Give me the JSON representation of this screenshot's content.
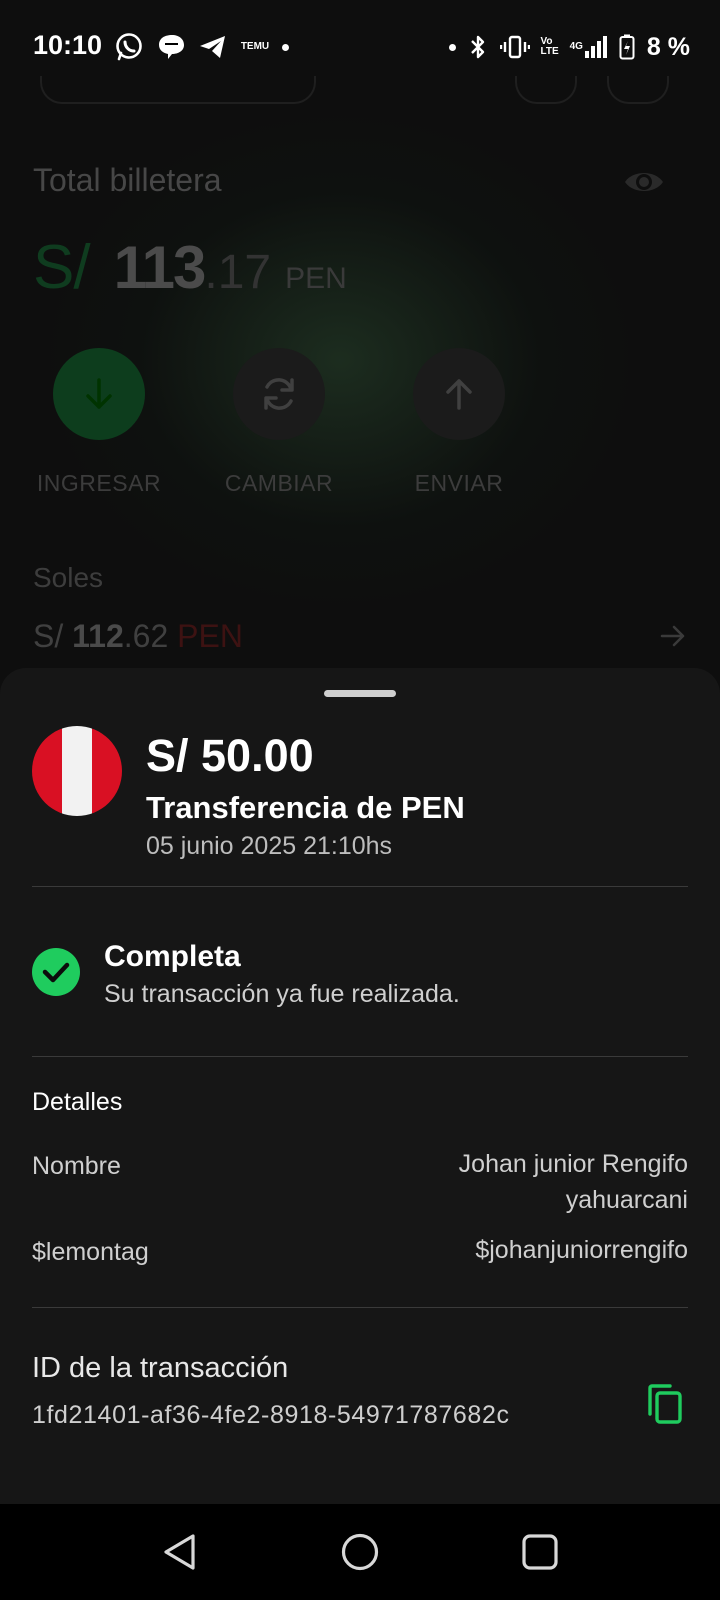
{
  "status_bar": {
    "time": "10:10",
    "temu_label": "TEMU",
    "signal_label": "Vo LTE",
    "network_label": "4G",
    "battery": "8 %"
  },
  "background": {
    "wallet_label": "Total billetera",
    "balance": {
      "currency": "S/",
      "integer": "113",
      "decimal": ".17",
      "code": "PEN"
    },
    "actions": [
      {
        "label": "INGRESAR",
        "icon": "arrow-down-icon"
      },
      {
        "label": "CAMBIAR",
        "icon": "refresh-icon"
      },
      {
        "label": "ENVIAR",
        "icon": "arrow-up-icon"
      }
    ],
    "soles_label": "Soles",
    "soles_balance": {
      "currency": "S/",
      "integer": "112",
      "decimal": ".62",
      "code": "PEN"
    }
  },
  "sheet": {
    "amount": "S/ 50.00",
    "title": "Transferencia de PEN",
    "date": "05 junio 2025 21:10hs",
    "status_title": "Completa",
    "status_desc": "Su transacción ya fue realizada.",
    "details_heading": "Detalles",
    "details": [
      {
        "label": "Nombre",
        "value_line1": "Johan junior Rengifo",
        "value_line2": "yahuarcani"
      },
      {
        "label": "$lemontag",
        "value_line1": "$johanjuniorrengifo"
      }
    ],
    "tx_id_label": "ID de la transacción",
    "tx_id": "1fd21401-af36-4fe2-8918-54971787682c"
  },
  "colors": {
    "accent_green": "#1fcc5e",
    "sheet_bg": "#161616",
    "flag_red": "#d91023",
    "flag_white": "#f2f2f2"
  }
}
